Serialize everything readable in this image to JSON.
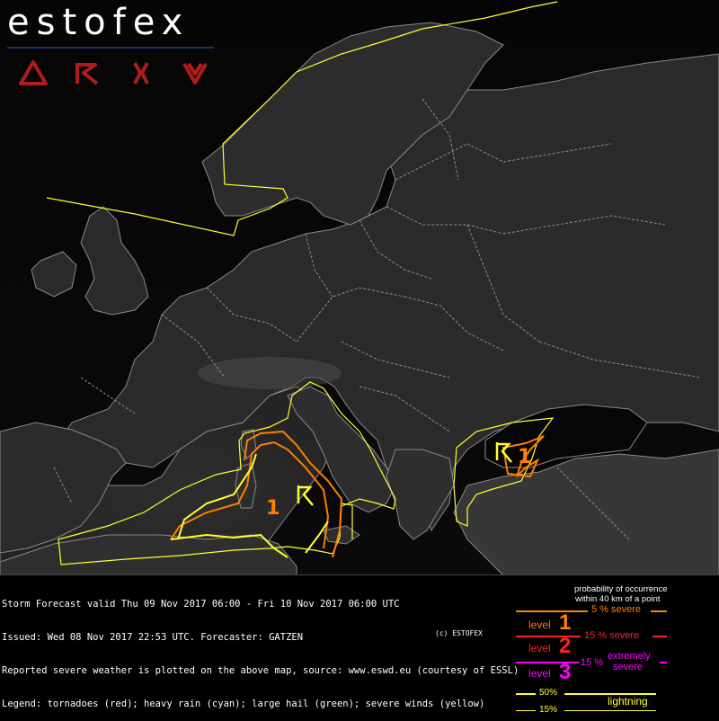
{
  "brand": {
    "name": "estofex"
  },
  "nav": {
    "items": [
      {
        "name": "nav-delta-icon",
        "color": "#b01c1c"
      },
      {
        "name": "nav-r-icon",
        "color": "#b01c1c"
      },
      {
        "name": "nav-k-icon",
        "color": "#b01c1c"
      },
      {
        "name": "nav-v-icon",
        "color": "#b01c1c"
      }
    ]
  },
  "map": {
    "level_labels": {
      "italy": "1",
      "black_sea": "1"
    },
    "colors": {
      "level1": "#ff7f00",
      "level2": "#ff2020",
      "level3": "#ff00ff",
      "lightning": "#ffff32",
      "border": "#9a9a9a"
    }
  },
  "info": {
    "line1": "Storm Forecast valid Thu 09 Nov 2017 06:00 - Fri 10 Nov 2017 06:00 UTC",
    "line2": "Issued: Wed 08 Nov 2017 22:53 UTC. Forecaster: GATZEN",
    "line3": "Reported severe weather is plotted on the above map, source: www.eswd.eu (courtesy of ESSL)",
    "line4": "Legend: tornadoes (red); heavy rain (cyan); large hail (green); severe winds (yellow)",
    "copyright": "(c) ESTOFEX"
  },
  "legend": {
    "title1": "probability of occurrence",
    "title2": "within 40 km of a point",
    "level_word": "level",
    "level1": "1",
    "level2": "2",
    "level3": "3",
    "severe5": "5 % severe",
    "severe15": "15 % severe",
    "pct15": "15 %",
    "extremely": "extremely",
    "severe": "severe",
    "lightning50": "50%",
    "lightning15": "15%",
    "lightning_label": "lightning"
  }
}
